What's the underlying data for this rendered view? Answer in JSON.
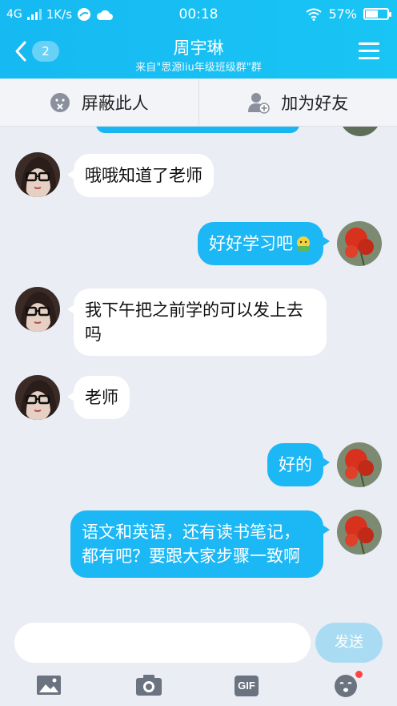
{
  "status_bar": {
    "network": "4G",
    "speed": "1K/s",
    "time": "00:18",
    "battery": "57%",
    "battery_level": 0.57
  },
  "nav": {
    "back_badge": "2",
    "title": "周宇琳",
    "subtitle": "来自\"思源liu年级班级群\"群"
  },
  "actions": {
    "block_label": "屏蔽此人",
    "add_friend_label": "加为好友"
  },
  "messages": [
    {
      "side": "in",
      "text": "哦哦知道了老师"
    },
    {
      "side": "out",
      "text": "好好学习吧"
    },
    {
      "side": "in",
      "text": "我下午把之前学的可以发上去吗"
    },
    {
      "side": "in",
      "text": "老师"
    },
    {
      "side": "out",
      "text": "好的"
    },
    {
      "side": "out",
      "text": "语文和英语，还有读书笔记，都有吧？要跟大家步骤一致啊"
    }
  ],
  "composer": {
    "send_label": "发送"
  },
  "toolbar": {
    "gif_label": "GIF",
    "icons": [
      "image-icon",
      "camera-icon",
      "gif-icon",
      "emoji-icon"
    ]
  },
  "colors": {
    "header": "#16b9f2",
    "bubble_out": "#1cb7f5",
    "send_disabled": "#a9dcf3"
  }
}
